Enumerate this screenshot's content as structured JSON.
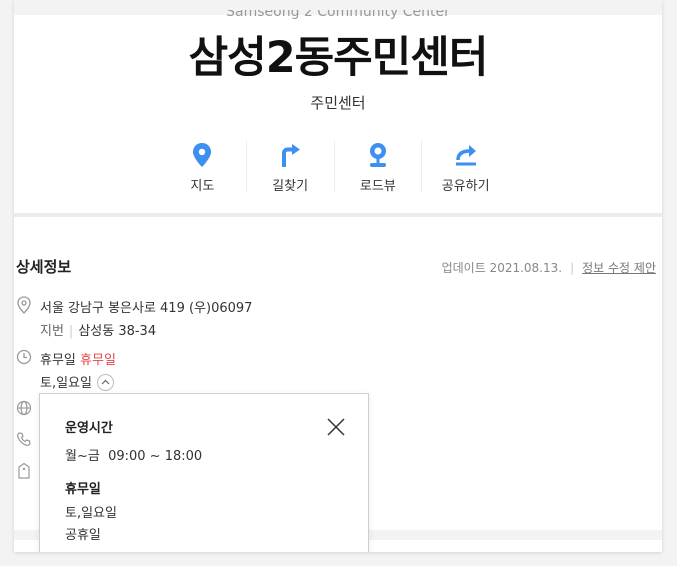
{
  "place": {
    "english_name": "Samseong 2 Community Center",
    "name": "삼성2동주민센터",
    "category": "주민센터"
  },
  "actions": [
    {
      "label": "지도",
      "icon": "map-pin-icon"
    },
    {
      "label": "길찾기",
      "icon": "directions-icon"
    },
    {
      "label": "로드뷰",
      "icon": "roadview-icon"
    },
    {
      "label": "공유하기",
      "icon": "share-icon"
    }
  ],
  "detail": {
    "title": "상세정보",
    "update_label": "업데이트 2021.08.13.",
    "suggest_label": "정보 수정 제안",
    "address": "서울 강남구 봉은사로 419 (우)06097",
    "jibun_label": "지번",
    "jibun_value": "삼성동 38-34",
    "closed_prefix": "휴무일",
    "closed_status": "휴무일",
    "closed_days": "토,일요일"
  },
  "popup": {
    "hours_title": "운영시간",
    "hours_value": "월~금  09:00 ~ 18:00",
    "holiday_title": "휴무일",
    "holiday_1": "토,일요일",
    "holiday_2": "공휴일"
  },
  "colors": {
    "accent": "#3d8ff0",
    "closed_red": "#e64545"
  }
}
